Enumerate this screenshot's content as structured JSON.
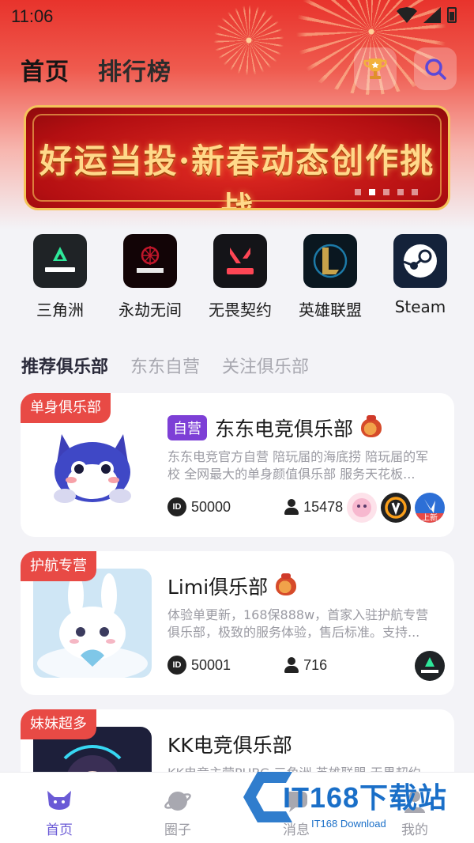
{
  "status_bar": {
    "time": "11:06"
  },
  "header": {
    "tab_home": "首页",
    "tab_ranking": "排行榜"
  },
  "banner": {
    "text": "好运当投·新春动态创作挑战",
    "slides": 5,
    "active_slide": 2
  },
  "games": [
    {
      "label": "三角洲",
      "icon": "delta-force-icon"
    },
    {
      "label": "永劫无间",
      "icon": "naraka-icon"
    },
    {
      "label": "无畏契约",
      "icon": "valorant-icon"
    },
    {
      "label": "英雄联盟",
      "icon": "league-of-legends-icon"
    },
    {
      "label": "Steam",
      "icon": "steam-icon"
    }
  ],
  "section_tabs": [
    "推荐俱乐部",
    "东东自营",
    "关注俱乐部"
  ],
  "clubs": [
    {
      "tag": "单身俱乐部",
      "badge": "自营",
      "name": "东东电竞俱乐部",
      "desc": "东东电竞官方自营 陪玩届的海底捞 陪玩届的军校 全网最大的单身颜值俱乐部 服务天花板...",
      "id": "50000",
      "members": "15478",
      "mini_new_label": "上新"
    },
    {
      "tag": "护航专营",
      "name": "Limi俱乐部",
      "desc": "体验单更新，168保888w，首家入驻护航专营俱乐部，极致的服务体验，售后标准。支持...",
      "id": "50001",
      "members": "716"
    },
    {
      "tag": "妹妹超多",
      "name": "KK电竞俱乐部",
      "desc": "KK电竞主营PUBG 三角洲 英雄联盟 无畏契约"
    }
  ],
  "id_icon_text": "ID",
  "bottom_nav": [
    "首页",
    "圈子",
    "消息",
    "我的"
  ],
  "watermark": {
    "text": "IT168下载站",
    "sub": "IT168 Download"
  },
  "colors": {
    "accent": "#6a5ad6",
    "tag": "#e84a45",
    "self_badge": "#7d3fd6"
  }
}
